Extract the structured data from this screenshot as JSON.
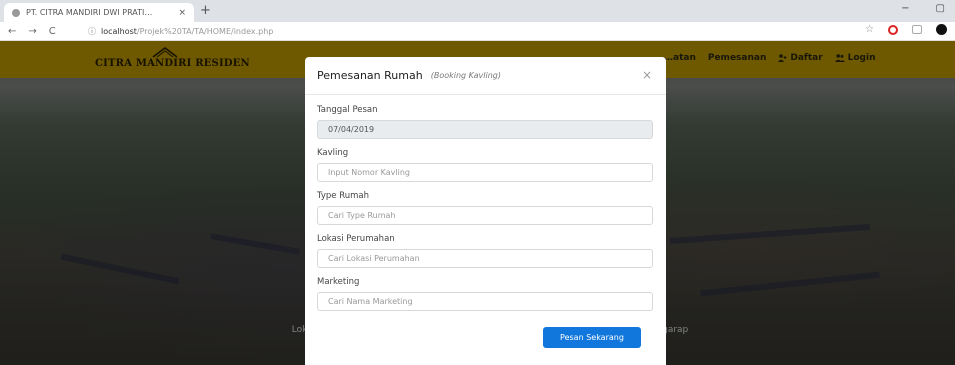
{
  "browser": {
    "tab_title": "PT. CITRA MANDIRI DWI PRATI…",
    "tab_close": "×",
    "new_tab": "+",
    "window_minimize": "−",
    "window_restore": "▢",
    "address_host": "localhost",
    "address_path": "/Projek%20TA/TA/HOME/index.php",
    "nav_back": "←",
    "nav_forward": "→",
    "nav_reload": "C",
    "bookmark_icon": "☆"
  },
  "site": {
    "brand_name": "CITRA MANDIRI RESIDEN",
    "menu": [
      {
        "label": "…atan",
        "icon": ""
      },
      {
        "label": "Pemesanan",
        "icon": ""
      },
      {
        "label": "Daftar",
        "icon": "user-plus-icon"
      },
      {
        "label": "Login",
        "icon": "users-icon"
      }
    ],
    "hero_caption": "Lokasi Citra yang sudah ………………………………………………… yang akan mulai digarap"
  },
  "modal": {
    "title": "Pemesanan Rumah",
    "subtitle": "(Booking Kavling)",
    "close": "×",
    "fields": [
      {
        "label": "Tanggal Pesan",
        "value": "07/04/2019",
        "placeholder": "",
        "readonly": true
      },
      {
        "label": "Kavling",
        "value": "",
        "placeholder": "Input Nomor Kavling",
        "readonly": false
      },
      {
        "label": "Type Rumah",
        "value": "",
        "placeholder": "Cari Type Rumah",
        "readonly": false
      },
      {
        "label": "Lokasi Perumahan",
        "value": "",
        "placeholder": "Cari Lokasi Perumahan",
        "readonly": false
      },
      {
        "label": "Marketing",
        "value": "",
        "placeholder": "Cari Nama Marketing",
        "readonly": false
      }
    ],
    "submit_label": "Pesan Sekarang"
  },
  "colors": {
    "navbar": "#c8a100",
    "primary_button": "#1177dd"
  }
}
